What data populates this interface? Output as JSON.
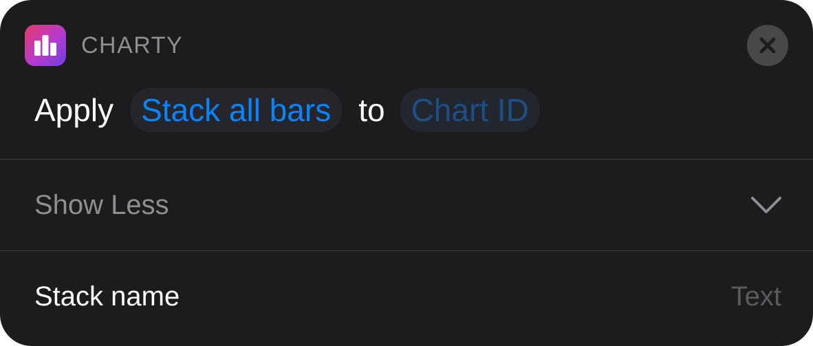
{
  "app": {
    "name": "CHARTY",
    "icon": "bar-chart-icon",
    "icon_gradient": [
      "#e63a6c",
      "#b43ccf",
      "#6e3fe0"
    ]
  },
  "close_button": {
    "icon": "close-icon"
  },
  "action": {
    "verb": "Apply",
    "option": "Stack all bars",
    "connector": "to",
    "parameter": "Chart ID"
  },
  "show_less": {
    "label": "Show Less",
    "icon": "chevron-down-icon"
  },
  "fields": [
    {
      "label": "Stack name",
      "placeholder": "Text",
      "value": ""
    }
  ],
  "colors": {
    "background": "#1c1c1e",
    "accent": "#0a84ff",
    "parameter_token": "#1f4e86",
    "secondary_text": "#8e8e93",
    "placeholder_text": "#5a5a5e",
    "divider": "#3a3a3c"
  }
}
